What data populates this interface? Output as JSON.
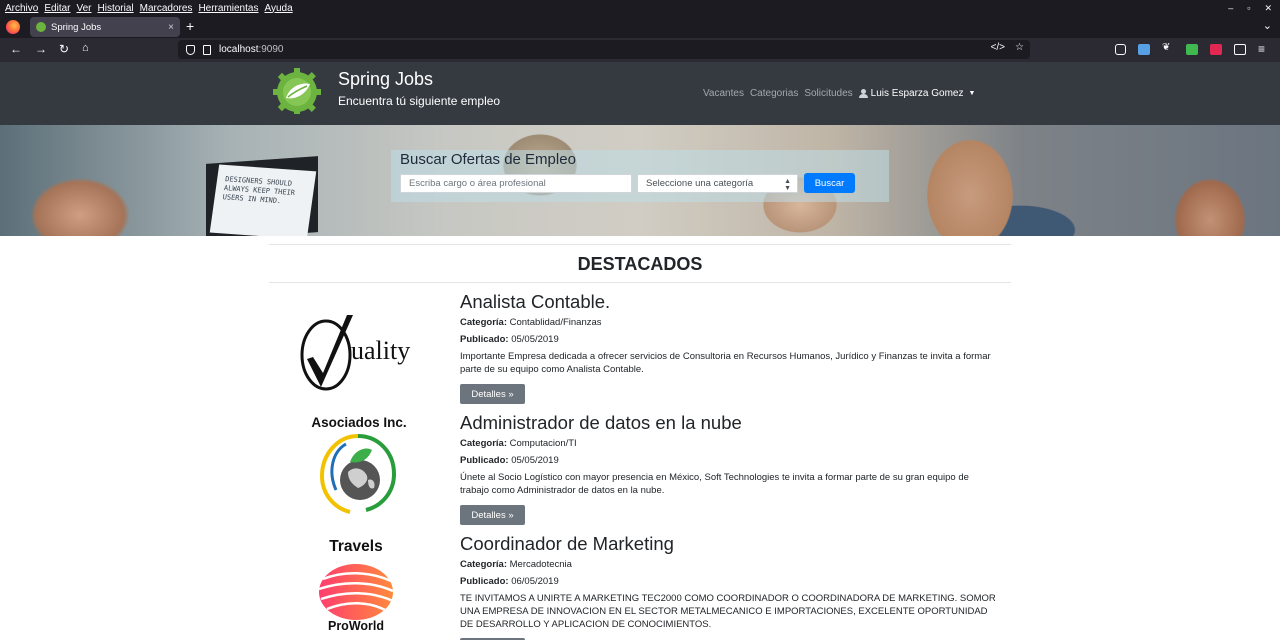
{
  "browser": {
    "menu": [
      "Archivo",
      "Editar",
      "Ver",
      "Historial",
      "Marcadores",
      "Herramientas",
      "Ayuda"
    ],
    "tab_title": "Spring Jobs",
    "tab_close": "×",
    "new_tab": "+",
    "url_host": "localhost",
    "url_port": ":9090"
  },
  "header": {
    "brand_title": "Spring Jobs",
    "brand_subtitle": "Encuentra tú siguiente empleo",
    "nav": [
      "Vacantes",
      "Categorias",
      "Solicitudes"
    ],
    "user": "Luis Esparza Gomez"
  },
  "hero": {
    "monitor_text": "DESIGNERS SHOULD ALWAYS KEEP THEIR USERS IN MIND.",
    "search_title": "Buscar Ofertas de Empleo",
    "search_placeholder": "Escriba cargo o área profesional",
    "category_select": "Seleccione una categoría",
    "search_button": "Buscar"
  },
  "section_title": "DESTACADOS",
  "labels": {
    "category": "Categoría:",
    "published": "Publicado:",
    "details": "Detalles »"
  },
  "jobs": [
    {
      "title": "Analista Contable.",
      "category": "Contablidad/Finanzas",
      "published": "05/05/2019",
      "description": "Importante Empresa dedicada a ofrecer servicios de Consultoria en Recursos Humanos, Jurídico y Finanzas te invita a formar parte de su equipo como Analista Contable.",
      "logo_text": "uality"
    },
    {
      "title": "Administrador de datos en la nube",
      "category": "Computacion/TI",
      "published": "05/05/2019",
      "description": "Únete al Socio Logístico con mayor presencia en México, Soft Technologies te invita a formar parte de su gran equipo de trabajo como Administrador de datos en la nube.",
      "logo_text": "Asociados Inc."
    },
    {
      "title": "Coordinador de Marketing",
      "category": "Mercadotecnia",
      "published": "06/05/2019",
      "description": "TE INVITAMOS A UNIRTE A MARKETING TEC2000 COMO COORDINADOR O COORDINADORA DE MARKETING. SOMOR UNA EMPRESA DE INNOVACION EN EL SECTOR METALMECANICO E IMPORTACIONES, EXCELENTE OPORTUNIDAD DE DESARROLLO Y APLICACION DE CONOCIMIENTOS.",
      "logo_text_top": "Travels",
      "logo_text_bottom": "ProWorld"
    }
  ],
  "colors": {
    "header_bg": "#343a40",
    "primary": "#007bff",
    "secondary": "#6c757d"
  }
}
